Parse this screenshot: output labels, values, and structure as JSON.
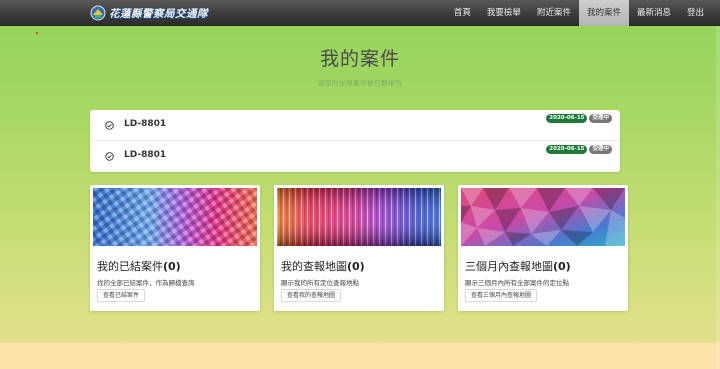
{
  "navbar": {
    "brand_title": "花蓮縣警察局交通隊",
    "links": [
      {
        "label": "首頁",
        "active": false
      },
      {
        "label": "我要檢舉",
        "active": false
      },
      {
        "label": "附近案件",
        "active": false
      },
      {
        "label": "我的案件",
        "active": true
      },
      {
        "label": "最新消息",
        "active": false
      },
      {
        "label": "登出",
        "active": false
      }
    ]
  },
  "header": {
    "title": "我的案件",
    "subtitle": "將您的全部案件依日期排列"
  },
  "cases": [
    {
      "id": "LD-8801",
      "date": "2020-06-15",
      "status": "受理中"
    },
    {
      "id": "LD-8801",
      "date": "2020-06-15",
      "status": "受理中"
    }
  ],
  "cards": [
    {
      "title": "我的已結案件",
      "count": "(0)",
      "description": "找的全部已結案件，作為歸檔查詢",
      "button": "查看已結案件"
    },
    {
      "title": "我的查報地圖",
      "count": "(0)",
      "description": "顯示我的所有定位查報地點",
      "button": "查看我的查報地圖"
    },
    {
      "title": "三個月內查報地圖",
      "count": "(0)",
      "description": "顯示三個月內所有全部案件的定位點",
      "button": "查看三個月內查報地圖"
    }
  ],
  "colors": {
    "status_date_badge": "#1f7a3a",
    "status_badge": "#777777",
    "navbar": "#3c3c3c"
  },
  "icons": {
    "case_row": "check-circle-icon",
    "brand": "police-logo-icon"
  }
}
